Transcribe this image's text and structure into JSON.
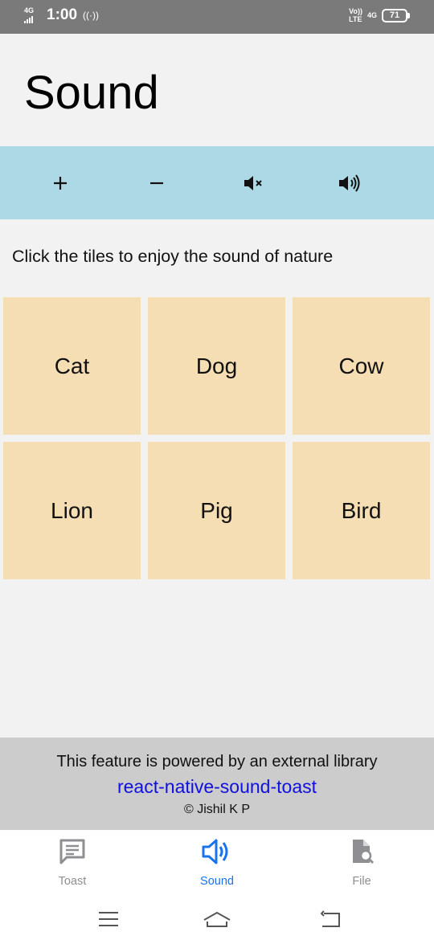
{
  "status_bar": {
    "network": "4G",
    "time": "1:00",
    "hotspot": "((·))",
    "volte": "Vo))",
    "lte": "LTE",
    "network_right": "4G",
    "battery": "71"
  },
  "header": {
    "title": "Sound"
  },
  "toolbar": {
    "buttons": [
      {
        "icon": "plus-icon"
      },
      {
        "icon": "minus-icon"
      },
      {
        "icon": "volume-mute-icon"
      },
      {
        "icon": "volume-up-icon"
      }
    ]
  },
  "main": {
    "instruction": "Click the tiles to enjoy the sound of nature",
    "tiles": [
      "Cat",
      "Dog",
      "Cow",
      "Lion",
      "Pig",
      "Bird"
    ]
  },
  "footer": {
    "text": "This feature is powered by an external library",
    "link": "react-native-sound-toast",
    "copyright": "© Jishil K P"
  },
  "tabs": [
    {
      "label": "Toast",
      "icon": "message-icon",
      "active": false
    },
    {
      "label": "Sound",
      "icon": "speaker-icon",
      "active": true
    },
    {
      "label": "File",
      "icon": "file-search-icon",
      "active": false
    }
  ],
  "colors": {
    "toolbar_bg": "#add8e6",
    "tile_bg": "#f5deb3",
    "footer_bg": "#cccccc",
    "active_tab": "#1a73e8",
    "link": "#1010e0"
  }
}
